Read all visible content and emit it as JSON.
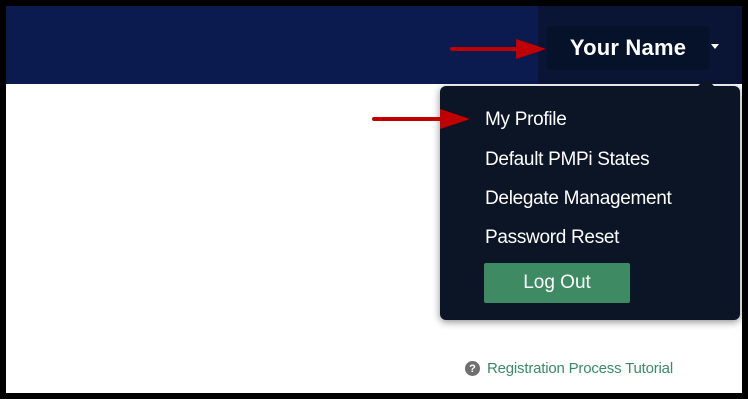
{
  "header": {
    "user_name": "Your Name"
  },
  "user_menu": {
    "items": [
      {
        "label": "My Profile"
      },
      {
        "label": "Default PMPi States"
      },
      {
        "label": "Delegate Management"
      },
      {
        "label": "Password Reset"
      }
    ],
    "logout_label": "Log Out"
  },
  "footer": {
    "help_icon_glyph": "?",
    "tutorial_link": "Registration Process Tutorial"
  },
  "colors": {
    "header_bg": "#0b1a4f",
    "menu_bg": "#0c1526",
    "logout_bg": "#3e8a63",
    "link_color": "#3a8a67",
    "annotation_arrow": "#c00000"
  }
}
